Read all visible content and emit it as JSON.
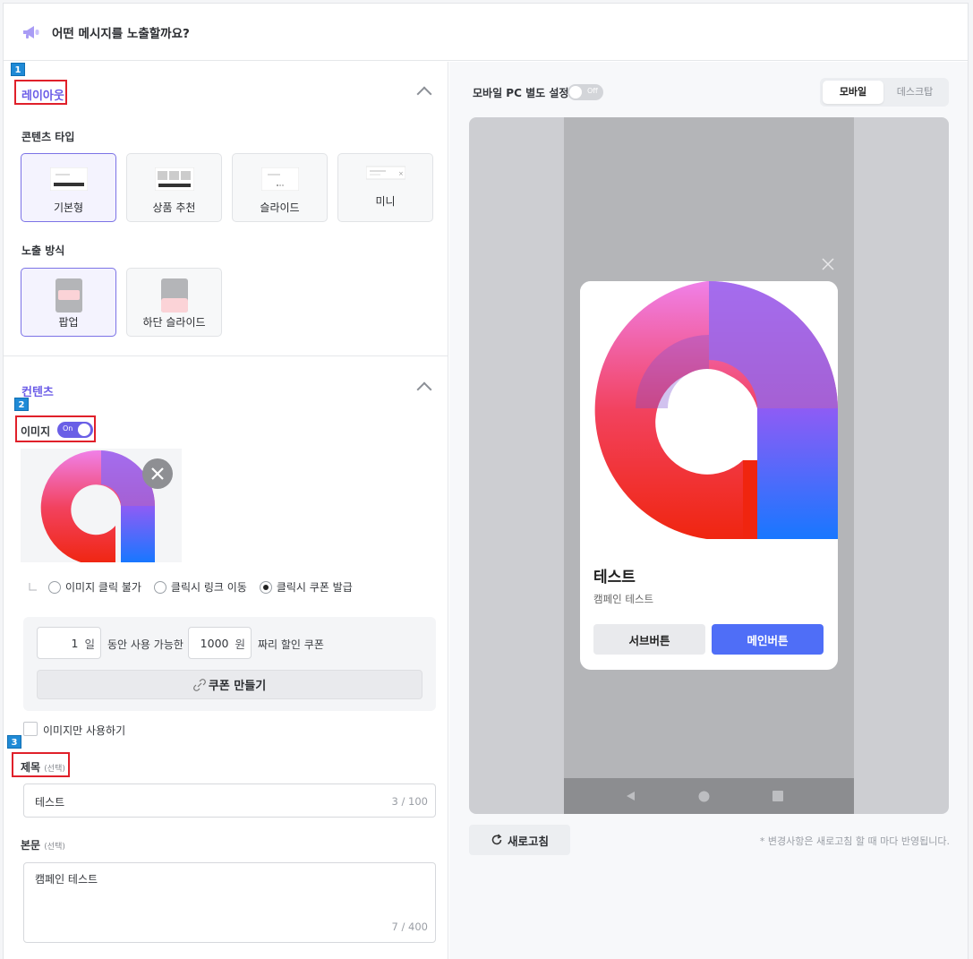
{
  "header": {
    "title": "어떤 메시지를 노출할까요?",
    "icon": "megaphone-icon"
  },
  "markers": [
    "1",
    "2",
    "3"
  ],
  "layout_section": {
    "title": "레이아웃",
    "content_type_label": "콘텐츠 타입",
    "content_types": [
      "기본형",
      "상품 추천",
      "슬라이드",
      "미니"
    ],
    "selected_content_type": "기본형",
    "display_label": "노출 방식",
    "display_modes": [
      "팝업",
      "하단 슬라이드"
    ],
    "selected_display_mode": "팝업"
  },
  "content_section": {
    "title": "컨텐츠",
    "image_label": "이미지",
    "image_toggle": "On",
    "click_options": [
      "이미지 클릭 불가",
      "클릭시 링크 이동",
      "클릭시 쿠폰 발급"
    ],
    "selected_click_option": "클릭시 쿠폰 발급",
    "coupon": {
      "days_value": "1",
      "days_unit": "일",
      "mid_text": "동안 사용 가능한",
      "amount_value": "1000",
      "amount_unit": "원",
      "tail_text": "짜리 할인 쿠폰",
      "make_button": "쿠폰 만들기"
    },
    "image_only_label": "이미지만 사용하기",
    "title_label": "제목",
    "optional_tag": "(선택)",
    "title_value": "테스트",
    "title_counter": "3 / 100",
    "body_label": "본문",
    "body_value": "캠페인 테스트",
    "body_counter": "7 / 400"
  },
  "preview_panel": {
    "separate_setting_label": "모바일 PC 별도 설정",
    "separate_toggle": "Off",
    "tabs": [
      "모바일",
      "데스크탑"
    ],
    "active_tab": "모바일",
    "popup": {
      "title": "테스트",
      "body": "캠페인 테스트",
      "sub_button": "서브버튼",
      "main_button": "메인버튼"
    },
    "refresh_button": "새로고침",
    "note": "* 변경사항은 새로고침 할 때 마다 반영됩니다."
  },
  "colors": {
    "accent": "#6a5fe6",
    "main_button": "#4f6ef7",
    "marker": "#1f8ad6",
    "highlight": "#e0202a"
  }
}
